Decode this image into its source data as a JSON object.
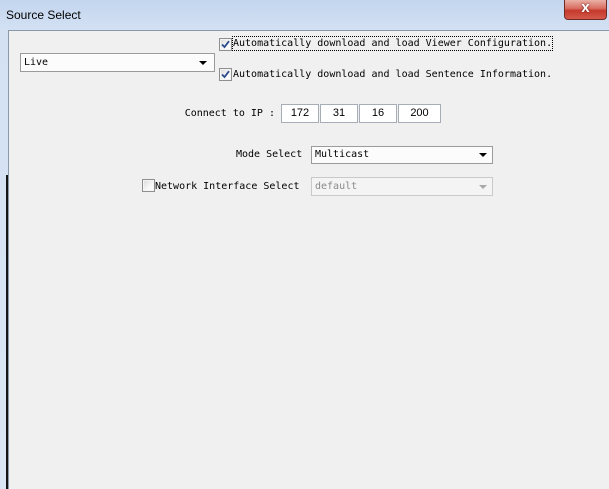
{
  "window": {
    "title": "Source Select",
    "close_label": "X"
  },
  "source": {
    "selected": "Live"
  },
  "auto_load": {
    "viewer_configuration": {
      "label": "Automatically download and load Viewer Configuration.",
      "checked": true,
      "focused": true
    },
    "sentence_information": {
      "label": "Automatically download and load Sentence Information.",
      "checked": true
    }
  },
  "connect": {
    "label": "Connect to IP :",
    "ip": [
      "172",
      "31",
      "16",
      "200"
    ]
  },
  "mode": {
    "label": "Mode Select",
    "selected": "Multicast"
  },
  "network_interface": {
    "label": "Network Interface Select",
    "checked": false,
    "selected": "default",
    "disabled": true
  },
  "icons": {
    "close": "close-icon",
    "dropdown": "chevron-down-icon",
    "check": "checkmark-icon"
  },
  "colors": {
    "title_bar": "#d3e1f3",
    "close_button": "#c5392c",
    "window_background": "#f0f0f0",
    "checkmark": "#2b4b8c",
    "disabled_text": "#8a8a8a"
  }
}
